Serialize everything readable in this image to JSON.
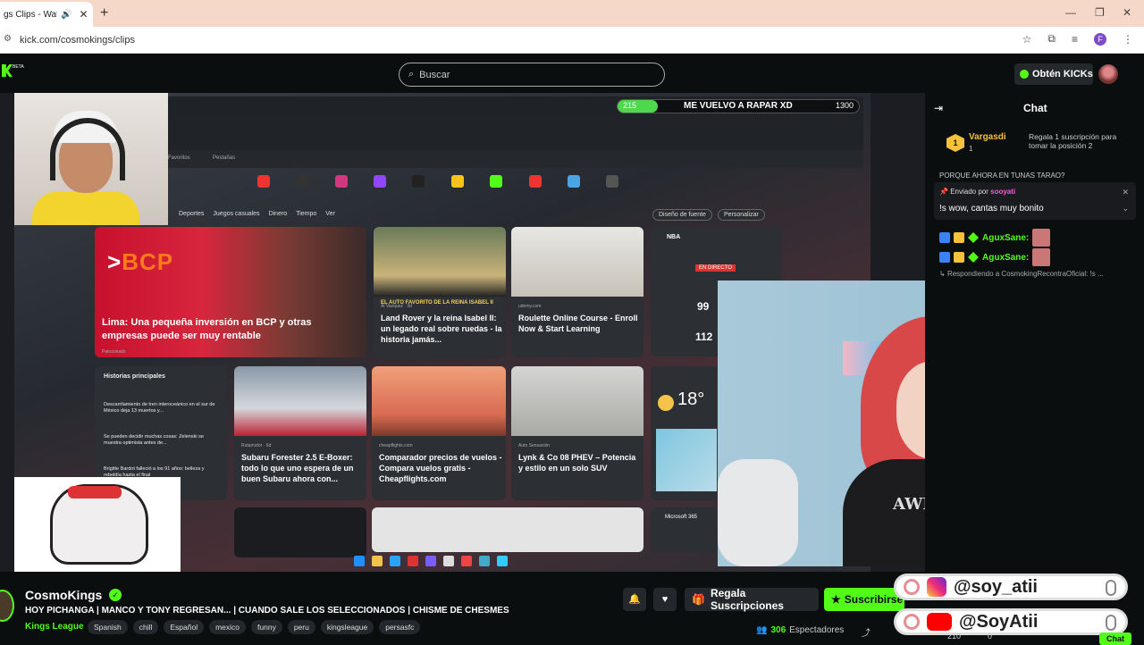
{
  "browser": {
    "tab_title": "gs Clips - Watch",
    "url": "kick.com/cosmokings/clips",
    "profile_initial": "F"
  },
  "header": {
    "beta_label": "BETA",
    "search_placeholder": "Buscar",
    "kicks_label": "Obtén KICKs"
  },
  "stream_overlay": {
    "goal_current": "215",
    "goal_title": "ME VUELVO A RAPAR XD",
    "goal_target": "1300",
    "goal_progress": 0.165,
    "news_nav": [
      "Deportes",
      "Juegos casuales",
      "Dinero",
      "Tiempo",
      "Ver"
    ],
    "feed_buttons": [
      "Diseño de fuente",
      "Personalizar"
    ],
    "favorites": [
      "Favoritos",
      "Pestañas"
    ],
    "weather_temp": "18°",
    "cards": [
      {
        "title": "Lima: Una pequeña inversión en BCP y otras empresas puede ser muy rentable",
        "source": "Patrocinado"
      },
      {
        "title": "Land Rover y la reina Isabel II: un legado real sobre ruedas - la historia jamás...",
        "source": "Al Vazquez · 3d",
        "banner": "EL AUTO FAVORITO DE LA REINA ISABEL II"
      },
      {
        "title": "Roulette Online Course - Enroll Now & Start Learning",
        "source": "udemy.com"
      },
      {
        "title": "Subaru Forester 2.5 E-Boxer: todo lo que uno espera de un buen Subaru ahora con...",
        "source": "Rutamotor · 6d"
      },
      {
        "title": "Comparador precios de vuelos - Compara vuelos gratis - Cheapflights.com",
        "source": "cheapflights.com"
      },
      {
        "title": "Lynk & Co 08 PHEV – Potencia y estilo en un solo SUV",
        "source": "Auto Sensación"
      }
    ],
    "stories_title": "Historias principales",
    "stories": [
      "Descarrilamiento de tren interoceánico en el sur de México deja 13 muertos y...",
      "Se pueden decidir muchas cosas: Zelenski se muestra optimista antes de...",
      "Brigitte Bardot falleció a los 91 años: belleza y rebeldía hasta el final"
    ],
    "sport_title": "NBA",
    "sport_live": "EN DIRECTO",
    "sport_scores": [
      "99",
      "112"
    ],
    "microsoft_label": "Microsoft 365",
    "bcp_logo": "BCP",
    "girl_shirt_text": "AWESOME"
  },
  "chat": {
    "title": "Chat",
    "gift_rank": "1",
    "gift_user": "Vargasdi",
    "gift_count": "1",
    "gift_info": "Regala 1 suscripción para tomar la posición 2",
    "partial_line": "PORQUE AHORA EN TUNAS TARAO?",
    "pinned_by_label": "Enviado por",
    "pinned_by_user": "sooyati",
    "pinned_message": "!s wow, cantas muy bonito",
    "messages": [
      {
        "user": "AguxSane:"
      },
      {
        "user": "AguxSane:"
      }
    ],
    "reply_line": "Respondiendo a CosmokingRecontraOficial: !s ..."
  },
  "stream_info": {
    "streamer": "CosmoKings",
    "title": "HOY PICHANGA | MANCO Y TONY REGRESAN... | CUANDO SALE LOS SELECCIONADOS | CHISME DE CHESMES",
    "category": "Kings League",
    "tags": [
      "Spanish",
      "chill",
      "Español",
      "mexico",
      "funny",
      "peru",
      "kingsleague",
      "persasfc"
    ],
    "regala_label": "Regala Suscripciones",
    "suscribir_label": "Suscribirse",
    "viewer_count": "306",
    "viewer_label": "Espectadores",
    "chat_foot": [
      "210",
      "0"
    ],
    "chat_send": "Chat"
  },
  "socials": [
    {
      "platform": "instagram",
      "handle": "@soy_atii"
    },
    {
      "platform": "youtube",
      "handle": "@SoyAtii"
    }
  ],
  "colors": {
    "kick_green": "#53fc18",
    "background": "#0b0e0f",
    "gold": "#f6c23a",
    "pink": "#ff5ad7"
  }
}
